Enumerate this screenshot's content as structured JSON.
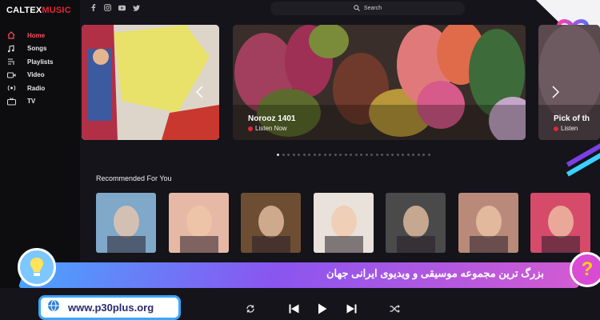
{
  "app": {
    "logo_part1": "CALTEX",
    "logo_part2": "MUSIC"
  },
  "sidebar": {
    "items": [
      {
        "label": "Home",
        "icon": "home-icon",
        "active": true
      },
      {
        "label": "Songs",
        "icon": "music-note-icon",
        "active": false
      },
      {
        "label": "Playlists",
        "icon": "playlist-icon",
        "active": false
      },
      {
        "label": "Video",
        "icon": "video-icon",
        "active": false
      },
      {
        "label": "Radio",
        "icon": "radio-icon",
        "active": false
      },
      {
        "label": "TV",
        "icon": "tv-icon",
        "active": false
      }
    ]
  },
  "topbar": {
    "social": [
      "facebook-icon",
      "instagram-icon",
      "youtube-icon",
      "twitter-icon"
    ],
    "search_placeholder": "Search"
  },
  "hero": {
    "main": {
      "title": "Norooz 1401",
      "subtitle": "Listen Now"
    },
    "right": {
      "title": "Pick of th",
      "subtitle": "Listen"
    }
  },
  "carousel": {
    "dot_count": 30,
    "active_dot": 0
  },
  "recommended": {
    "title": "Recommended For You",
    "albums": [
      {
        "name": "album-1",
        "color": "#7fa8c9"
      },
      {
        "name": "album-2",
        "color": "#e6b9a6"
      },
      {
        "name": "album-3",
        "color": "#6e4e33"
      },
      {
        "name": "album-4",
        "color": "#e9e2da"
      },
      {
        "name": "album-5",
        "color": "#4a4a4a"
      },
      {
        "name": "album-6",
        "color": "#b98a7a"
      },
      {
        "name": "album-7",
        "color": "#d64a6a"
      }
    ]
  },
  "banner": {
    "text": "بزرگ ترین مجموعه موسیقی و ویدیوی ایرانی جهان",
    "url": "www.p30plus.org"
  },
  "player": {
    "controls": [
      "repeat-icon",
      "previous-icon",
      "play-icon",
      "next-icon",
      "shuffle-icon"
    ]
  },
  "colors": {
    "accent": "#e0273a",
    "active_nav": "#ff4e5b",
    "background": "#14141a"
  }
}
